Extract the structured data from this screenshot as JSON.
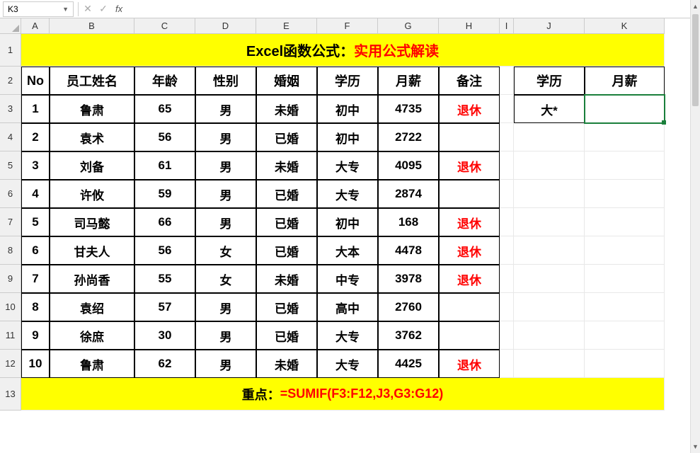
{
  "name_box": "K3",
  "formula_input": "",
  "columns": [
    "A",
    "B",
    "C",
    "D",
    "E",
    "F",
    "G",
    "H",
    "I",
    "J",
    "K"
  ],
  "col_widths": [
    "wA",
    "wB",
    "wC",
    "wD",
    "wE",
    "wF",
    "wG",
    "wH",
    "wI",
    "wJ",
    "wK"
  ],
  "row_numbers": [
    "1",
    "2",
    "3",
    "4",
    "5",
    "6",
    "7",
    "8",
    "9",
    "10",
    "11",
    "12",
    "13"
  ],
  "banner": {
    "black": "Excel函数公式：",
    "red": "实用公式解读"
  },
  "headers": {
    "no": "No",
    "name": "员工姓名",
    "age": "年龄",
    "gender": "性别",
    "marital": "婚姻",
    "edu": "学历",
    "salary": "月薪",
    "remark": "备注",
    "edu2": "学历",
    "salary2": "月薪"
  },
  "lookup": {
    "edu_value": "大*",
    "salary_value": ""
  },
  "rows": [
    {
      "no": "1",
      "name": "鲁肃",
      "age": "65",
      "gender": "男",
      "marital": "未婚",
      "edu": "初中",
      "salary": "4735",
      "remark": "退休"
    },
    {
      "no": "2",
      "name": "袁术",
      "age": "56",
      "gender": "男",
      "marital": "已婚",
      "edu": "初中",
      "salary": "2722",
      "remark": ""
    },
    {
      "no": "3",
      "name": "刘备",
      "age": "61",
      "gender": "男",
      "marital": "未婚",
      "edu": "大专",
      "salary": "4095",
      "remark": "退休"
    },
    {
      "no": "4",
      "name": "许攸",
      "age": "59",
      "gender": "男",
      "marital": "已婚",
      "edu": "大专",
      "salary": "2874",
      "remark": ""
    },
    {
      "no": "5",
      "name": "司马懿",
      "age": "66",
      "gender": "男",
      "marital": "已婚",
      "edu": "初中",
      "salary": "168",
      "remark": "退休"
    },
    {
      "no": "6",
      "name": "甘夫人",
      "age": "56",
      "gender": "女",
      "marital": "已婚",
      "edu": "大本",
      "salary": "4478",
      "remark": "退休"
    },
    {
      "no": "7",
      "name": "孙尚香",
      "age": "55",
      "gender": "女",
      "marital": "未婚",
      "edu": "中专",
      "salary": "3978",
      "remark": "退休"
    },
    {
      "no": "8",
      "name": "袁绍",
      "age": "57",
      "gender": "男",
      "marital": "已婚",
      "edu": "高中",
      "salary": "2760",
      "remark": ""
    },
    {
      "no": "9",
      "name": "徐庶",
      "age": "30",
      "gender": "男",
      "marital": "已婚",
      "edu": "大专",
      "salary": "3762",
      "remark": ""
    },
    {
      "no": "10",
      "name": "鲁肃",
      "age": "62",
      "gender": "男",
      "marital": "未婚",
      "edu": "大专",
      "salary": "4425",
      "remark": "退休"
    }
  ],
  "footer": {
    "label": "重点：",
    "formula": "=SUMIF(F3:F12,J3,G3:G12)"
  }
}
